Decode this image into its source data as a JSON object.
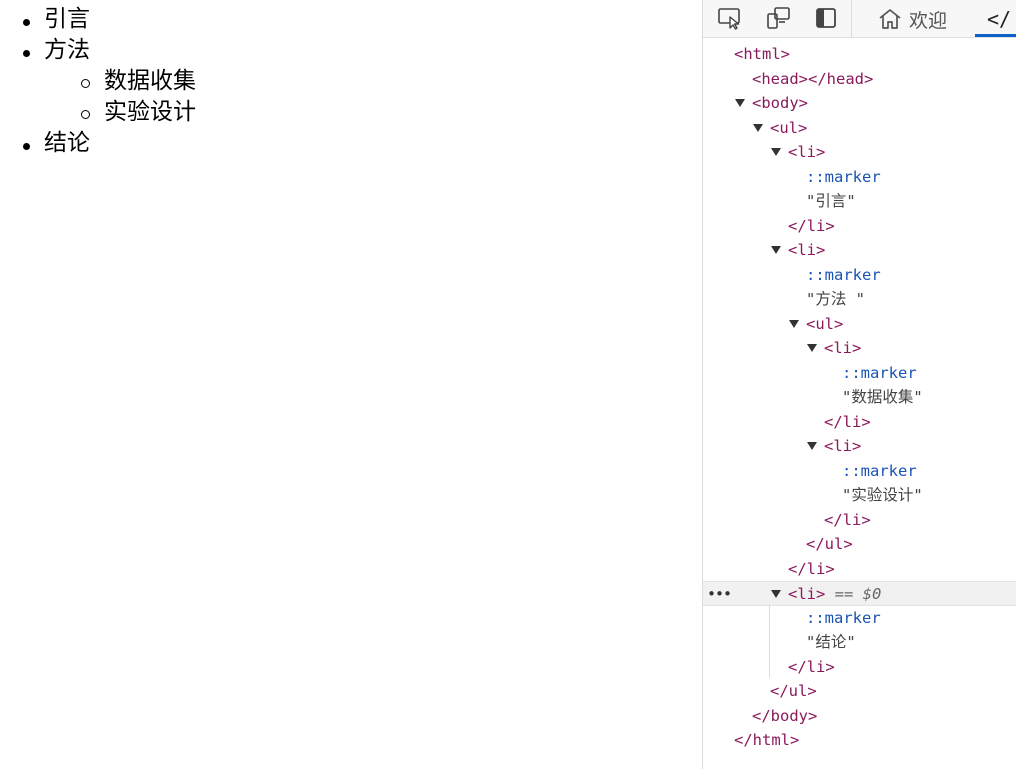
{
  "page": {
    "items": [
      {
        "label": "引言",
        "level": 0
      },
      {
        "label": "方法",
        "level": 0
      },
      {
        "label": "数据收集",
        "level": 1
      },
      {
        "label": "实验设计",
        "level": 1
      },
      {
        "label": "结论",
        "level": 0
      }
    ]
  },
  "devtools": {
    "toolbar": {
      "inspect_icon": "inspect-element-icon",
      "device_icon": "device-emulation-icon",
      "dock_icon": "dock-side-icon",
      "welcome_tab_label": "欢迎",
      "elements_tab_glyph": "</"
    },
    "tree": {
      "html_open": "<html>",
      "head": "<head></head>",
      "body_open": "<body>",
      "ul_open": "<ul>",
      "li_open": "<li>",
      "marker": "::marker",
      "text_intro": "\"引言\"",
      "li_close": "</li>",
      "text_method": "\"方法 \"",
      "text_data": "\"数据收集\"",
      "text_design": "\"实验设计\"",
      "ul_close": "</ul>",
      "selected_suffix": "== $0",
      "text_conclusion": "\"结论\"",
      "body_close": "</body>",
      "html_close": "</html>",
      "dots": "•••"
    },
    "colors": {
      "tag": "#8a1a5c",
      "pseudo": "#1a54b4",
      "accent": "#0a62c9",
      "selected_bg": "#f1f1f1"
    }
  }
}
